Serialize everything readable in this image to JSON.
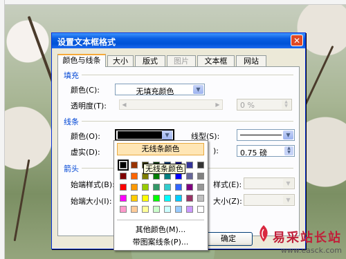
{
  "dialog": {
    "title": "设置文本框格式",
    "close_glyph": "✕"
  },
  "tabs": [
    {
      "label": "颜色与线条",
      "active": true
    },
    {
      "label": "大小"
    },
    {
      "label": "版式"
    },
    {
      "label": "图片",
      "disabled": true
    },
    {
      "label": "文本框"
    },
    {
      "label": "网站"
    }
  ],
  "fill": {
    "section": "填充",
    "color_label": "颜色(C):",
    "color_value": "无填充颜色",
    "transparency_label": "透明度(T):",
    "transparency_value": "0 %"
  },
  "line": {
    "section": "线条",
    "color_label": "颜色(O):",
    "color_swatch": "#000000",
    "style_label": "线型(S):",
    "dash_label": "虚实(D):",
    "weight_label_tail": "):",
    "weight_value": "0.75 磅"
  },
  "arrows": {
    "section": "箭头",
    "begin_style_label": "始端样式(B):",
    "begin_size_label": "始端大小(I):",
    "end_style_label_tail": "样式(E):",
    "end_size_label_tail": "大小(Z):"
  },
  "color_dropdown": {
    "no_color": "无线条颜色",
    "tooltip": "无线条颜色",
    "more_colors": "其他颜色(M)...",
    "patterned_lines": "带图案线条(P)...",
    "palette": [
      [
        "#000000",
        "#993300",
        "#333300",
        "#003300",
        "#003366",
        "#000080",
        "#333399",
        "#333333"
      ],
      [
        "#800000",
        "#ff6600",
        "#808000",
        "#008000",
        "#008080",
        "#0000ff",
        "#666699",
        "#808080"
      ],
      [
        "#ff0000",
        "#ff9900",
        "#99cc00",
        "#339966",
        "#33cccc",
        "#3366ff",
        "#800080",
        "#969696"
      ],
      [
        "#ff00ff",
        "#ffcc00",
        "#ffff00",
        "#00ff00",
        "#00ffff",
        "#00ccff",
        "#993366",
        "#c0c0c0"
      ],
      [
        "#ff99cc",
        "#ffcc99",
        "#ffff99",
        "#ccffcc",
        "#ccffff",
        "#99ccff",
        "#cc99ff",
        "#ffffff"
      ]
    ]
  },
  "buttons": {
    "ok": "确定"
  },
  "watermark": {
    "brand": "易采站长站",
    "url": "www.easck.com"
  }
}
